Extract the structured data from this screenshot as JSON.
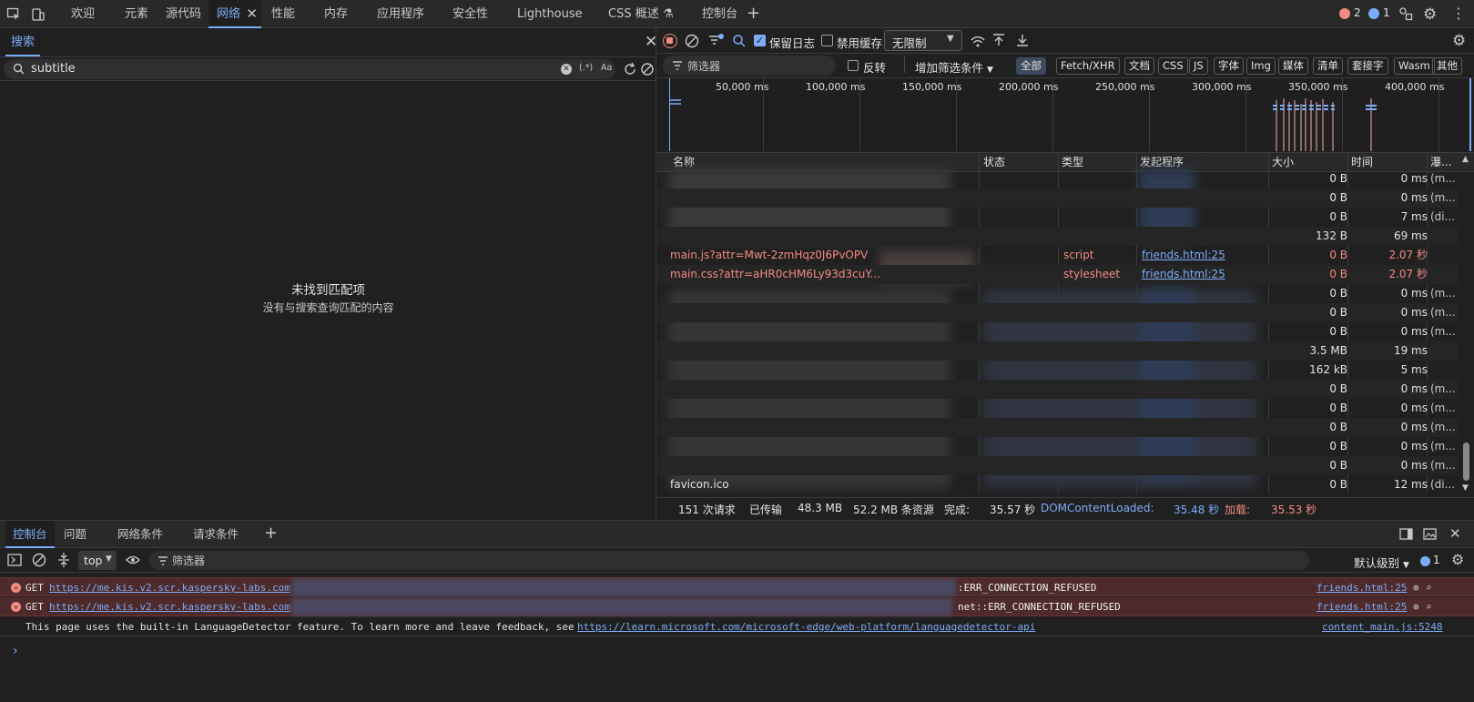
{
  "top_tabs": [
    "欢迎",
    "元素",
    "源代码",
    "网络",
    "性能",
    "内存",
    "应用程序",
    "安全性",
    "Lighthouse",
    "CSS 概述 ⚗",
    "控制台"
  ],
  "top_counts": {
    "errors": "2",
    "messages": "1"
  },
  "search_panel": {
    "tab_label": "搜索",
    "query": "subtitle",
    "regex_label": "(.*)",
    "case_label": "Aa",
    "empty_title": "未找到匹配项",
    "empty_desc": "没有与搜索查询匹配的内容"
  },
  "network_toolbar": {
    "preserve_log": "保留日志",
    "disable_cache": "禁用缓存",
    "throttle": "无限制"
  },
  "filter_bar": {
    "placeholder": "筛选器",
    "invert": "反转",
    "more_filters": "增加筛选条件",
    "chips": [
      "全部",
      "Fetch/XHR",
      "文档",
      "CSS",
      "JS",
      "字体",
      "Img",
      "媒体",
      "清单",
      "套接字",
      "Wasm",
      "其他"
    ]
  },
  "timeline_ticks": [
    "50,000 ms",
    "100,000 ms",
    "150,000 ms",
    "200,000 ms",
    "250,000 ms",
    "300,000 ms",
    "350,000 ms",
    "400,000 ms"
  ],
  "columns": [
    "名称",
    "状态",
    "类型",
    "发起程序",
    "大小",
    "时间",
    "瀑..."
  ],
  "rows": [
    {
      "name": "",
      "type": "",
      "initiator": "",
      "size": "0 B",
      "time": "0 ms",
      "waterfall": "(m..."
    },
    {
      "name": "",
      "type": "",
      "initiator": "",
      "size": "0 B",
      "time": "0 ms",
      "waterfall": "(m..."
    },
    {
      "name": "",
      "type": "",
      "initiator": "",
      "size": "0 B",
      "time": "7 ms",
      "waterfall": "(di..."
    },
    {
      "name": "",
      "type": "",
      "initiator": "",
      "size": "132 B",
      "time": "69 ms",
      "waterfall": ""
    },
    {
      "name": "main.js?attr=Mwt-2zmHqz0J6PvOPV",
      "type": "script",
      "initiator": "friends.html:25",
      "size": "0 B",
      "time": "2.07 秒",
      "waterfall": ""
    },
    {
      "name": "main.css?attr=aHR0cHM6Ly93d3cuY...",
      "type": "stylesheet",
      "initiator": "friends.html:25",
      "size": "0 B",
      "time": "2.07 秒",
      "waterfall": ""
    },
    {
      "name": "",
      "type": "",
      "initiator": "",
      "size": "0 B",
      "time": "0 ms",
      "waterfall": "(m..."
    },
    {
      "name": "",
      "type": "",
      "initiator": "",
      "size": "0 B",
      "time": "0 ms",
      "waterfall": "(m..."
    },
    {
      "name": "",
      "type": "",
      "initiator": "",
      "size": "0 B",
      "time": "0 ms",
      "waterfall": "(m..."
    },
    {
      "name": "",
      "type": "",
      "initiator": "",
      "size": "3.5 MB",
      "time": "19 ms",
      "waterfall": ""
    },
    {
      "name": "",
      "type": "",
      "initiator": "",
      "size": "162 kB",
      "time": "5 ms",
      "waterfall": ""
    },
    {
      "name": "",
      "type": "",
      "initiator": "",
      "size": "0 B",
      "time": "0 ms",
      "waterfall": "(m..."
    },
    {
      "name": "",
      "type": "",
      "initiator": "",
      "size": "0 B",
      "time": "0 ms",
      "waterfall": "(m..."
    },
    {
      "name": "",
      "type": "",
      "initiator": "",
      "size": "0 B",
      "time": "0 ms",
      "waterfall": "(m..."
    },
    {
      "name": "",
      "type": "",
      "initiator": "",
      "size": "0 B",
      "time": "0 ms",
      "waterfall": "(m..."
    },
    {
      "name": "",
      "type": "",
      "initiator": "",
      "size": "0 B",
      "time": "0 ms",
      "waterfall": "(m..."
    },
    {
      "name": "favicon.ico",
      "type": "",
      "initiator": "",
      "size": "0 B",
      "time": "12 ms",
      "waterfall": "(di..."
    }
  ],
  "status_bar": {
    "requests": "151 次请求",
    "transferred_label": "已传输",
    "transferred": "48.3 MB",
    "resources": "52.2 MB 条资源",
    "finish_label": "完成:",
    "finish": "35.57 秒",
    "dcl_label": "DOMContentLoaded:",
    "dcl": "35.48 秒",
    "load_label": "加载:",
    "load": "35.53 秒"
  },
  "console_tabs": [
    "控制台",
    "问题",
    "网络条件",
    "请求条件"
  ],
  "console_toolbar": {
    "context": "top",
    "filter_placeholder": "筛选器",
    "level": "默认级别",
    "count": "1"
  },
  "console_messages": [
    {
      "prefix": "GET",
      "url": "https://me.kis.v2.scr.kaspersky-labs.com",
      "error": ":ERR_CONNECTION_REFUSED",
      "source": "friends.html:25"
    },
    {
      "prefix": "GET",
      "url": "https://me.kis.v2.scr.kaspersky-labs.com",
      "error": "net::ERR_CONNECTION_REFUSED",
      "source": "friends.html:25"
    }
  ],
  "info_message": {
    "text": "This page uses the built-in LanguageDetector feature. To learn more and leave feedback, see",
    "url": "https://learn.microsoft.com/microsoft-edge/web-platform/languagedetector-api",
    "source": "content_main.js:5248"
  },
  "colors": {
    "accent": "#7cacf8",
    "error": "#f28b82",
    "error_bg": "#4e2a2a",
    "record": "#f28b82"
  }
}
